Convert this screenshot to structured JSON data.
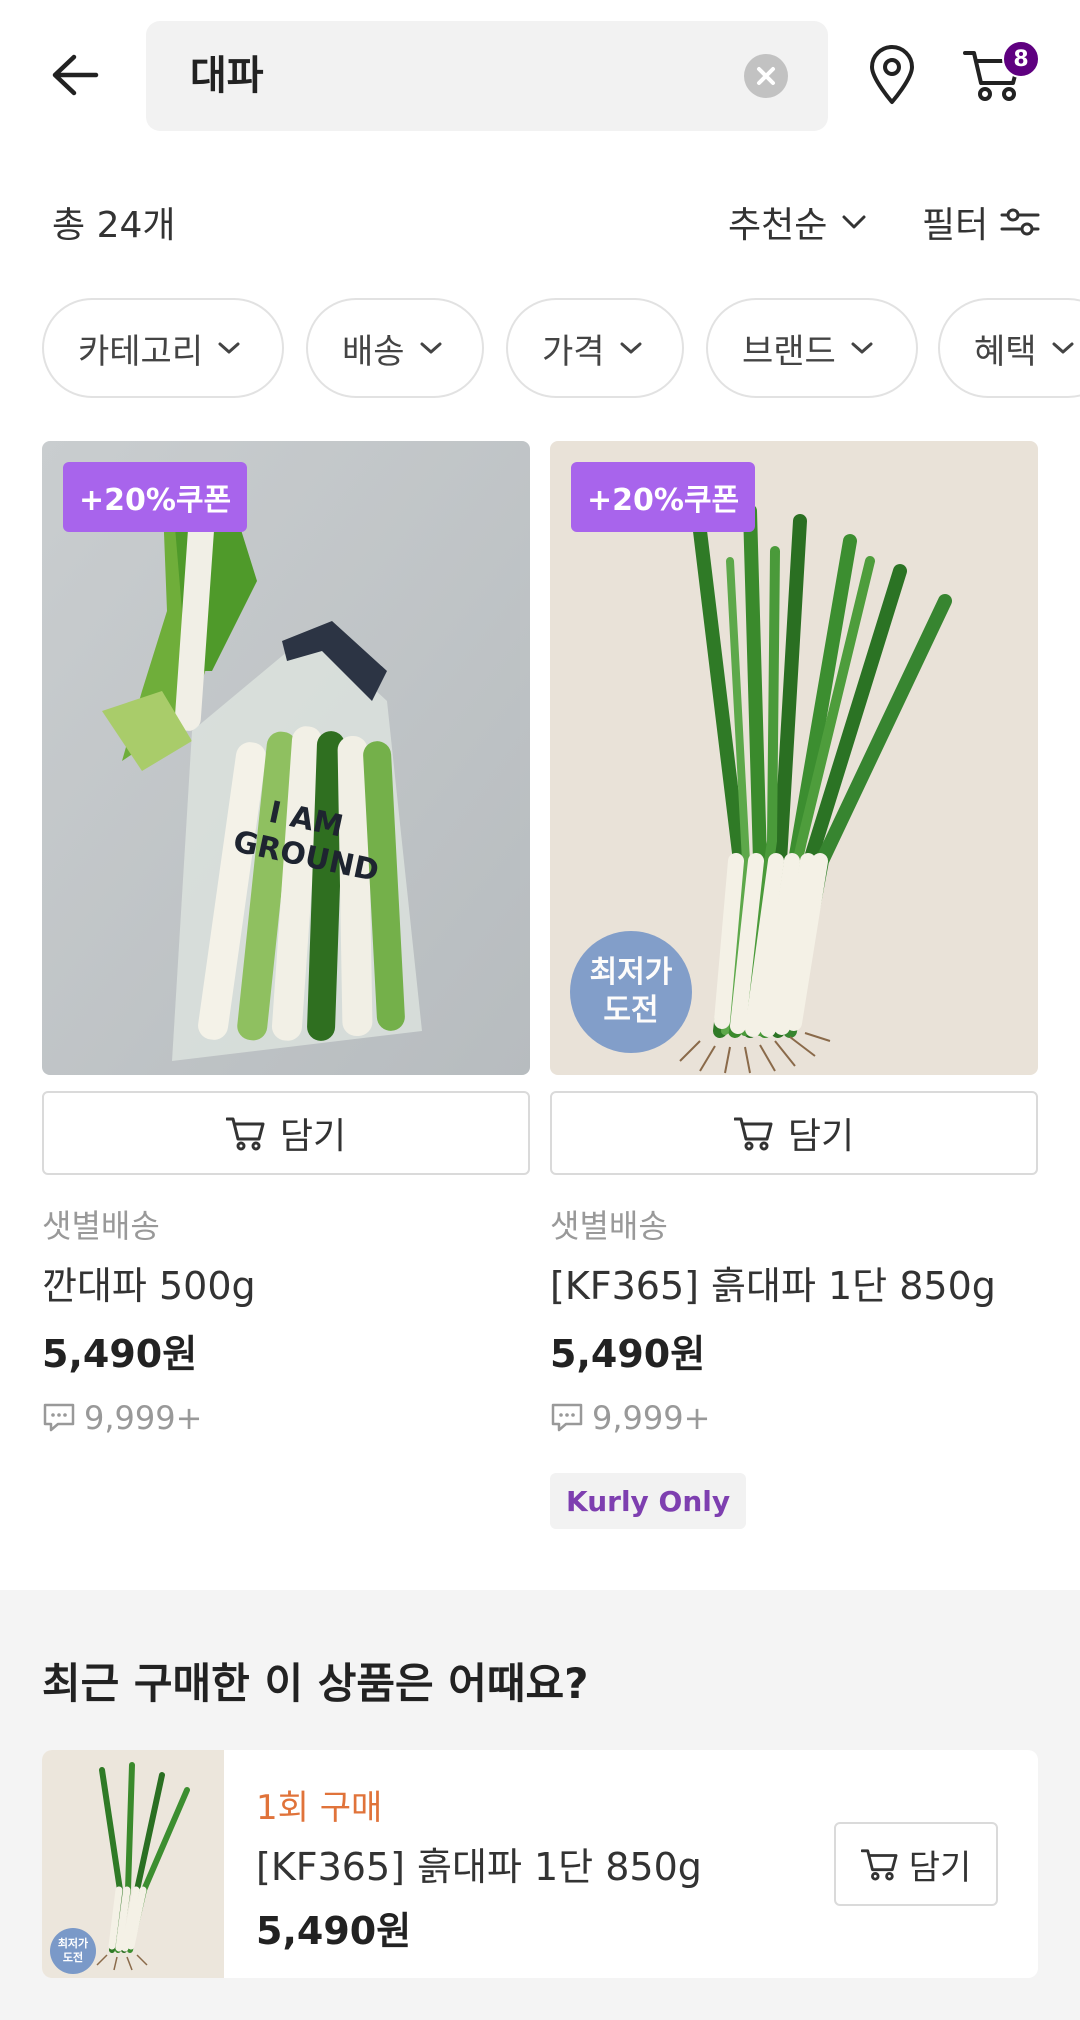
{
  "header": {
    "search_query": "대파",
    "cart_count": "8"
  },
  "sortbar": {
    "total": "총 24개",
    "sort_label": "추천순",
    "filter_label": "필터"
  },
  "chips": [
    "카테고리",
    "배송",
    "가격",
    "브랜드",
    "혜택"
  ],
  "products": [
    {
      "coupon": "+20%쿠폰",
      "add_label": "담기",
      "delivery": "샛별배송",
      "name": "깐대파 500g",
      "price": "5,490원",
      "reviews": "9,999+",
      "image_text": "I AM GROUND"
    },
    {
      "coupon": "+20%쿠폰",
      "lowest_line1": "최저가",
      "lowest_line2": "도전",
      "add_label": "담기",
      "delivery": "샛별배송",
      "name": "[KF365] 흙대파 1단 850g",
      "price": "5,490원",
      "reviews": "9,999+",
      "tag": "Kurly Only"
    }
  ],
  "recent": {
    "title": "최근 구매한 이 상품은 어때요?",
    "item": {
      "tag": "1회 구매",
      "name": "[KF365] 흙대파 1단 850g",
      "price": "5,490원",
      "add_label": "담기",
      "thumb_badge_line1": "최저가",
      "thumb_badge_line2": "도전"
    }
  },
  "colors": {
    "brand_purple": "#5f0080",
    "coupon_purple": "#a864ec",
    "recent_tag_orange": "#e0733a"
  }
}
